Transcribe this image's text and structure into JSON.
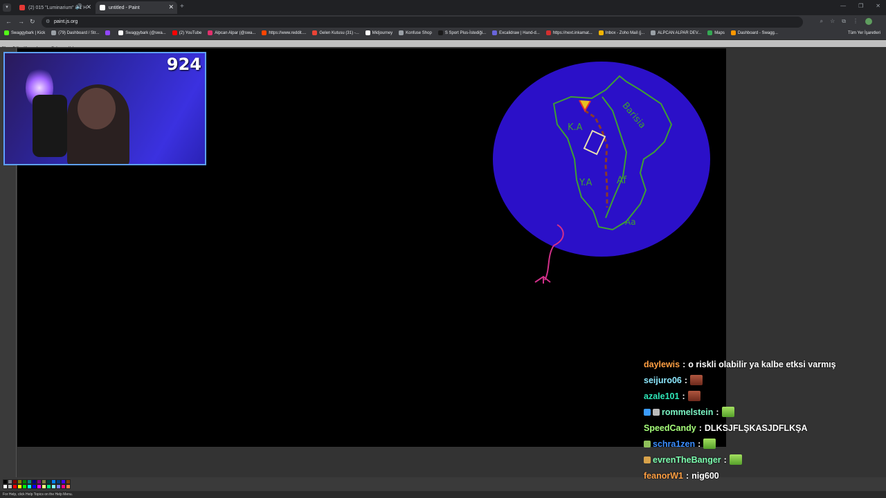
{
  "browser": {
    "tabs": [
      {
        "title": "(2) 015 \"Luminarium\" // 1 H",
        "active": false,
        "favicon_color": "#e53935"
      },
      {
        "title": "untitled - Paint",
        "active": true,
        "favicon_color": "#ffffff"
      }
    ],
    "url": "paint.js.org",
    "bookmarks": [
      {
        "label": "Swaggybark | Kick",
        "color": "#53fc18"
      },
      {
        "label": "(79) Dashboard / Str...",
        "color": "#9aa0a6"
      },
      {
        "label": "",
        "color": "#9146ff"
      },
      {
        "label": "Swaggybark (@swa...",
        "color": "#ffffff"
      },
      {
        "label": "(2) YouTube",
        "color": "#ff0000"
      },
      {
        "label": "Alpcan Alpar (@swa...",
        "color": "#e1306c"
      },
      {
        "label": "https://www.reddit....",
        "color": "#ff4500"
      },
      {
        "label": "Gelen Kutusu (31) -...",
        "color": "#ea4335"
      },
      {
        "label": "Midjourney",
        "color": "#ffffff"
      },
      {
        "label": "Konfuse Shop",
        "color": "#9aa0a6"
      },
      {
        "label": "S Sport Plus-İstediği...",
        "color": "#1a1a1a"
      },
      {
        "label": "Excalidraw | Hand-d...",
        "color": "#6965db"
      },
      {
        "label": "https://next.inkamat...",
        "color": "#d32f2f"
      },
      {
        "label": "Inbox - Zoho Mail (j...",
        "color": "#f4b400"
      },
      {
        "label": "ALPCAN ALPAR DEV...",
        "color": "#9aa0a6"
      },
      {
        "label": "Maps",
        "color": "#34a853"
      },
      {
        "label": "Dashboard - Swagg...",
        "color": "#ff9800"
      }
    ],
    "all_bookmarks_label": "Tüm Yer İşaretleri"
  },
  "paint": {
    "menu": [
      "File",
      "Edit",
      "View",
      "Image",
      "Options",
      "Help"
    ],
    "status": "For Help, click Help Topics on the Help Menu.",
    "palette": [
      "#000000",
      "#808080",
      "#800000",
      "#808000",
      "#008000",
      "#008080",
      "#000080",
      "#800080",
      "#808040",
      "#004040",
      "#0080ff",
      "#004080",
      "#4000ff",
      "#804000",
      "#ffffff",
      "#c0c0c0",
      "#ff0000",
      "#ffff00",
      "#00ff00",
      "#00ffff",
      "#0000ff",
      "#ff00ff",
      "#ffff80",
      "#00ff80",
      "#80ffff",
      "#8080ff",
      "#ff0080",
      "#ff8040"
    ]
  },
  "drawing_labels": {
    "region1": "Barisia",
    "region2": "K.A",
    "region3": "Y.A",
    "region4": "Af",
    "region5": "Aa"
  },
  "webcam": {
    "counter": "924"
  },
  "chat": [
    {
      "user": "daylewis",
      "color": "#ff9f43",
      "message": "o riskli olabilir ya kalbe etksi varmış",
      "emote": "",
      "badges": []
    },
    {
      "user": "seijuro06",
      "color": "#8de8ff",
      "message": "",
      "emote": "angry",
      "badges": []
    },
    {
      "user": "azale101",
      "color": "#2ee6b8",
      "message": "",
      "emote": "angry",
      "badges": []
    },
    {
      "user": "rommelstein",
      "color": "#7bf5c4",
      "message": "",
      "emote": "frog",
      "badges": [
        "#3b9cff",
        "#bbbbbb"
      ]
    },
    {
      "user": "SpeedCandy",
      "color": "#a6ff7a",
      "message": "DLKSJFLŞKASJDFLKŞA",
      "emote": "",
      "badges": []
    },
    {
      "user": "schra1zen",
      "color": "#3a8dff",
      "message": "",
      "emote": "frog",
      "badges": [
        "#8fbf5a"
      ]
    },
    {
      "user": "evrenTheBanger",
      "color": "#7dffb0",
      "message": "",
      "emote": "frog",
      "badges": [
        "#d8a24a"
      ]
    },
    {
      "user": "feanorW1",
      "color": "#ff9f43",
      "message": "nig600",
      "emote": "",
      "badges": []
    }
  ]
}
